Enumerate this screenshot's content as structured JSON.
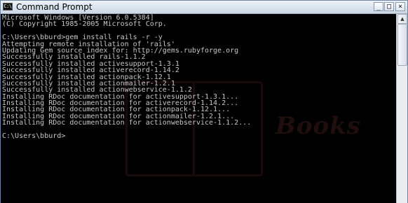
{
  "window": {
    "title": "Command Prompt",
    "app_icon": "C:\\",
    "controls": {
      "minimize_glyph": "_",
      "maximize_glyph": "□",
      "close_glyph": "×"
    }
  },
  "console": {
    "lines": [
      "Microsoft Windows [Version 6.0.5384]",
      "(C) Copyright 1985-2005 Microsoft Corp.",
      "",
      "C:\\Users\\bburd>gem install rails -r -y",
      "Attempting remote installation of 'rails'",
      "Updating Gem source index for: http://gems.rubyforge.org",
      "Successfully installed rails-1.1.2",
      "Successfully installed activesupport-1.3.1",
      "Successfully installed activerecord-1.14.2",
      "Successfully installed actionpack-1.12.1",
      "Successfully installed actionmailer-1.2.1",
      "Successfully installed actionwebservice-1.1.2",
      "Installing RDoc documentation for activesupport-1.3.1...",
      "Installing RDoc documentation for activerecord-1.14.2...",
      "Installing RDoc documentation for actionpack-1.12.1...",
      "Installing RDoc documentation for actionmailer-1.2.1...",
      "Installing RDoc documentation for actionwebservice-1.1.2...",
      "",
      "C:\\Users\\bburd>"
    ],
    "watermark": "Books"
  },
  "scrollbar": {
    "up_glyph": "▲"
  },
  "colors": {
    "console_bg": "#000000",
    "console_text": "#c8c8c8",
    "titlebar": "#dfe7f0"
  },
  "icons": [
    "console-app-icon",
    "minimize-icon",
    "maximize-icon",
    "close-icon",
    "scroll-up-icon"
  ]
}
